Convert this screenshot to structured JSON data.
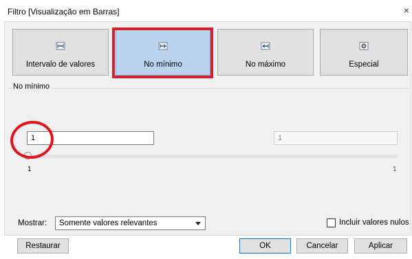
{
  "dialog": {
    "title": "Filtro [Visualização em Barras]",
    "close": "×"
  },
  "modes": [
    {
      "label": "Intervalo de valores",
      "icon": "range-icon"
    },
    {
      "label": "No mínimo",
      "icon": "at-least-icon",
      "selected": true
    },
    {
      "label": "No máximo",
      "icon": "at-most-icon"
    },
    {
      "label": "Especial",
      "icon": "special-icon"
    }
  ],
  "section": {
    "label": "No mínimo"
  },
  "min_value": "1",
  "max_value": "1",
  "slider": {
    "min_label": "1",
    "max_label": "1"
  },
  "show": {
    "label": "Mostrar:",
    "selected": "Somente valores relevantes"
  },
  "include_nulls": {
    "label": "Incluir valores nulos",
    "checked": false
  },
  "buttons": {
    "reset": "Restaurar",
    "ok": "OK",
    "cancel": "Cancelar",
    "apply": "Aplicar"
  },
  "colors": {
    "selected_tile": "#bad3ee",
    "highlight": "#d3212d",
    "circle": "#e0141a"
  }
}
